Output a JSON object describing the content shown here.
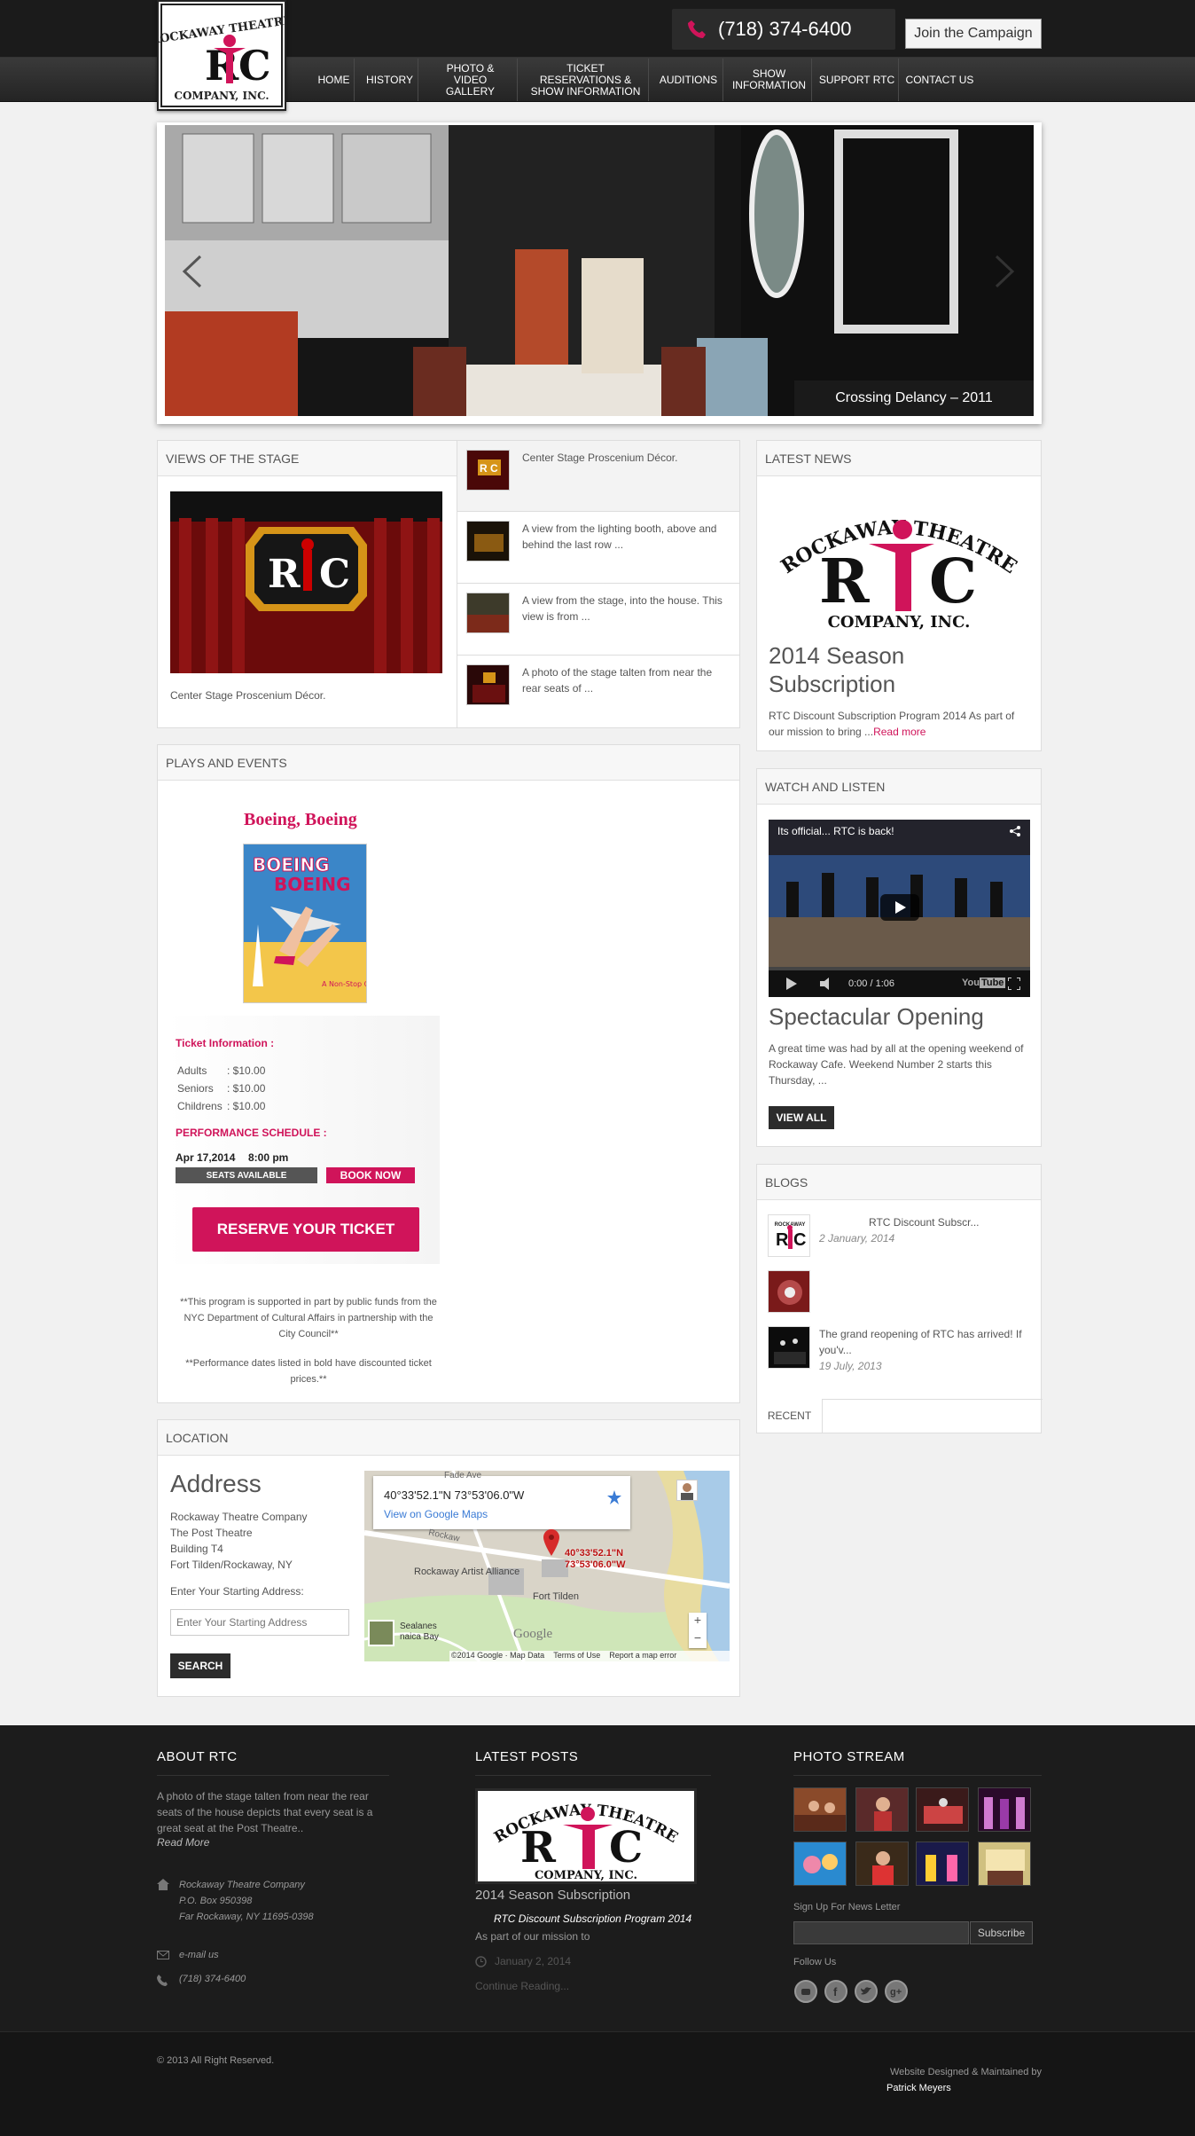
{
  "header": {
    "logo_alt": "Rockaway Theatre Company, Inc.",
    "phone": "(718) 374-6400",
    "join_button": "Join the Campaign"
  },
  "nav": [
    {
      "label": "HOME"
    },
    {
      "label": "HISTORY"
    },
    {
      "label": "PHOTO & VIDEO GALLERY"
    },
    {
      "label": "TICKET RESERVATIONS & SHOW INFORMATION"
    },
    {
      "label": "AUDITIONS"
    },
    {
      "label": "SHOW INFORMATION"
    },
    {
      "label": "SUPPORT RTC"
    },
    {
      "label": "CONTACT US"
    }
  ],
  "slider": {
    "caption": "Crossing Delancy – 2011"
  },
  "views": {
    "title": "VIEWS OF THE STAGE",
    "featured_caption": "Center Stage Proscenium Décor.",
    "items": [
      {
        "text": "Center Stage Proscenium Décor."
      },
      {
        "text": "A view from the lighting booth, above and behind the last row ..."
      },
      {
        "text": "A view from the stage, into the house. This view is from ..."
      },
      {
        "text": "A photo of the stage talten from near the rear seats of ..."
      }
    ]
  },
  "latest_news": {
    "title": "LATEST NEWS",
    "headline": "2014 Season Subscription",
    "body": "RTC Discount Subscription Program 2014 As part of our mission to bring ...",
    "read_more": "Read more"
  },
  "watch": {
    "title": "WATCH AND LISTEN",
    "video_title": "Its official... RTC is back!",
    "video_time": "0:00 / 1:06",
    "headline": "Spectacular Opening",
    "body": "A great time was had by all at the opening weekend of Rockaway Cafe. Weekend Number 2 starts this Thursday, ...",
    "view_all": "VIEW ALL"
  },
  "blogs": {
    "title": "BLOGS",
    "items": [
      {
        "title": "RTC Discount Subscr...",
        "date": "2 January, 2014"
      },
      {
        "title": "",
        "date": ""
      },
      {
        "title": "The grand reopening of RTC has arrived!  If you'v...",
        "date": "19 July, 2013"
      }
    ],
    "tab": "RECENT"
  },
  "plays": {
    "title": "PLAYS AND EVENTS",
    "show_title": "Boeing, Boeing",
    "poster_text": "BOEING BOEING",
    "poster_sub": "A Non-Stop Comedy!",
    "ticket_info_label": "Ticket Information :",
    "prices": [
      {
        "type": "Adults",
        "price": ": $10.00"
      },
      {
        "type": "Seniors",
        "price": ": $10.00"
      },
      {
        "type": "Childrens",
        "price": ": $10.00"
      }
    ],
    "schedule_label": "PERFORMANCE SCHEDULE :",
    "schedule_date": "Apr 17,2014",
    "schedule_time": "8:00 pm",
    "seats": "SEATS AVAILABLE",
    "book": "BOOK NOW",
    "reserve": "RESERVE YOUR TICKET",
    "note1": "**This program is supported in part by public funds from the NYC Department of Cultural Affairs in partnership with the City Council**",
    "note2": "**Performance dates listed in bold have discounted ticket prices.**"
  },
  "location": {
    "title": "LOCATION",
    "heading": "Address",
    "lines": [
      "Rockaway Theatre Company",
      "The Post Theatre",
      "Building T4",
      "Fort Tilden/Rockaway, NY"
    ],
    "start_label": "Enter Your Starting Address:",
    "start_placeholder": "Enter Your Starting Address",
    "search": "SEARCH",
    "map": {
      "coords": "40°33'52.1\"N 73°53'06.0\"W",
      "view_link": "View on Google Maps",
      "pin_label_1": "40°33'52.1\"N",
      "pin_label_2": "73°53'06.0\"W",
      "place1": "Rockaway Artist Alliance",
      "place2": "Fort Tilden",
      "place3": "Sealanes",
      "place4": "naica Bay",
      "road": "Rockaw",
      "road2": "Fade Ave",
      "brand": "Google",
      "footer": "©2014 Google · Map Data",
      "terms": "Terms of Use",
      "report": "Report a map error",
      "zoom_in": "+",
      "zoom_out": "−"
    }
  },
  "footer": {
    "about_title": "ABOUT RTC",
    "about_text": "A photo of the stage talten from near the rear seats of the house depicts that every seat is a great seat at the Post Theatre..",
    "read_more": "Read More",
    "address": [
      "Rockaway Theatre Company",
      "P.O. Box 950398",
      "Far Rockaway, NY 11695-0398"
    ],
    "email": "e-mail us",
    "phone": "(718) 374-6400",
    "posts_title": "LATEST POSTS",
    "post_title": "2014 Season Subscription",
    "post_sub": "RTC Discount Subscription Program 2014",
    "post_text": "As part of our mission to",
    "post_date": "January 2, 2014",
    "continue": "Continue Reading...",
    "photo_title": "PHOTO STREAM",
    "newsletter_label": "Sign Up For News Letter",
    "subscribe": "Subscribe",
    "follow": "Follow Us",
    "copyright": "© 2013 All Right Reserved.",
    "credit1": "Website Designed & Maintained by",
    "credit2": "Patrick Meyers"
  }
}
